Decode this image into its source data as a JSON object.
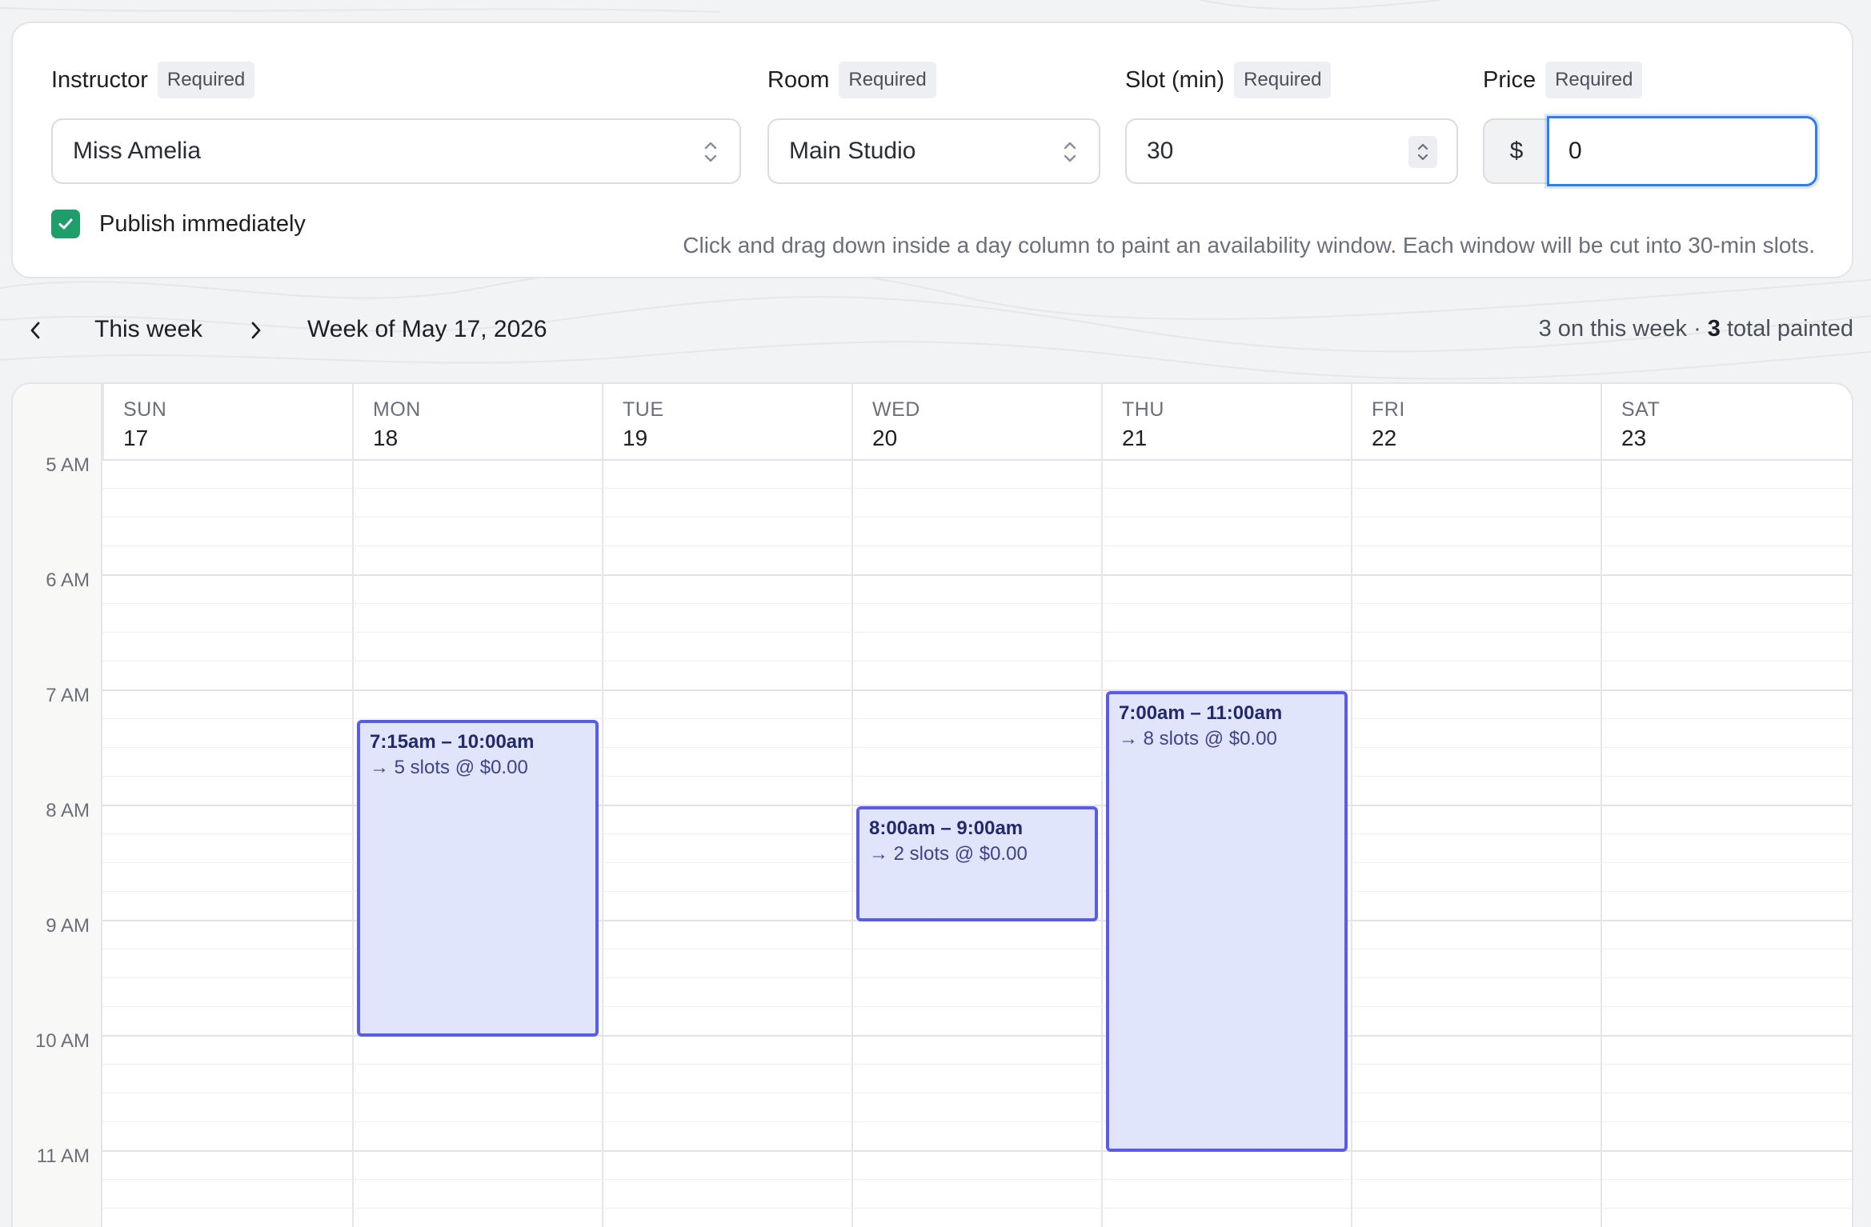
{
  "form": {
    "instructor": {
      "label": "Instructor",
      "badge": "Required",
      "value": "Miss Amelia"
    },
    "room": {
      "label": "Room",
      "badge": "Required",
      "value": "Main Studio"
    },
    "slot": {
      "label": "Slot (min)",
      "badge": "Required",
      "value": "30"
    },
    "price": {
      "label": "Price",
      "badge": "Required",
      "prefix": "$",
      "value": "0"
    },
    "publish": {
      "label": "Publish immediately",
      "checked": true
    },
    "hint": "Click and drag down inside a day column to paint an availability window. Each window will be cut into 30-min slots."
  },
  "nav": {
    "this_week": "This week",
    "week_of": "Week of May 17, 2026",
    "counts_prefix": "3 on this week · ",
    "counts_total": "3",
    "counts_suffix": " total painted"
  },
  "calendar": {
    "days": [
      {
        "dow": "SUN",
        "num": "17"
      },
      {
        "dow": "MON",
        "num": "18"
      },
      {
        "dow": "TUE",
        "num": "19"
      },
      {
        "dow": "WED",
        "num": "20"
      },
      {
        "dow": "THU",
        "num": "21"
      },
      {
        "dow": "FRI",
        "num": "22"
      },
      {
        "dow": "SAT",
        "num": "23"
      }
    ],
    "hours": [
      "5 AM",
      "6 AM",
      "7 AM",
      "8 AM",
      "9 AM",
      "10 AM",
      "11 AM"
    ],
    "blocks": [
      {
        "day": "MON",
        "time": "7:15am – 10:00am",
        "slots": "→ 5 slots @ $0.00"
      },
      {
        "day": "WED",
        "time": "8:00am – 9:00am",
        "slots": "→ 2 slots @ $0.00"
      },
      {
        "day": "THU",
        "time": "7:00am – 11:00am",
        "slots": "→ 8 slots @ $0.00"
      }
    ]
  },
  "colors": {
    "accent": "#5b5ce6",
    "block_fill": "#e0e5fb",
    "focus": "#2f7cf6",
    "checkbox": "#1f9d6b"
  },
  "icons": {
    "select": "chevron-up-down-icon",
    "spinner": "spinner-icon",
    "prev": "chevron-left-icon",
    "next": "chevron-right-icon",
    "check": "check-icon"
  }
}
